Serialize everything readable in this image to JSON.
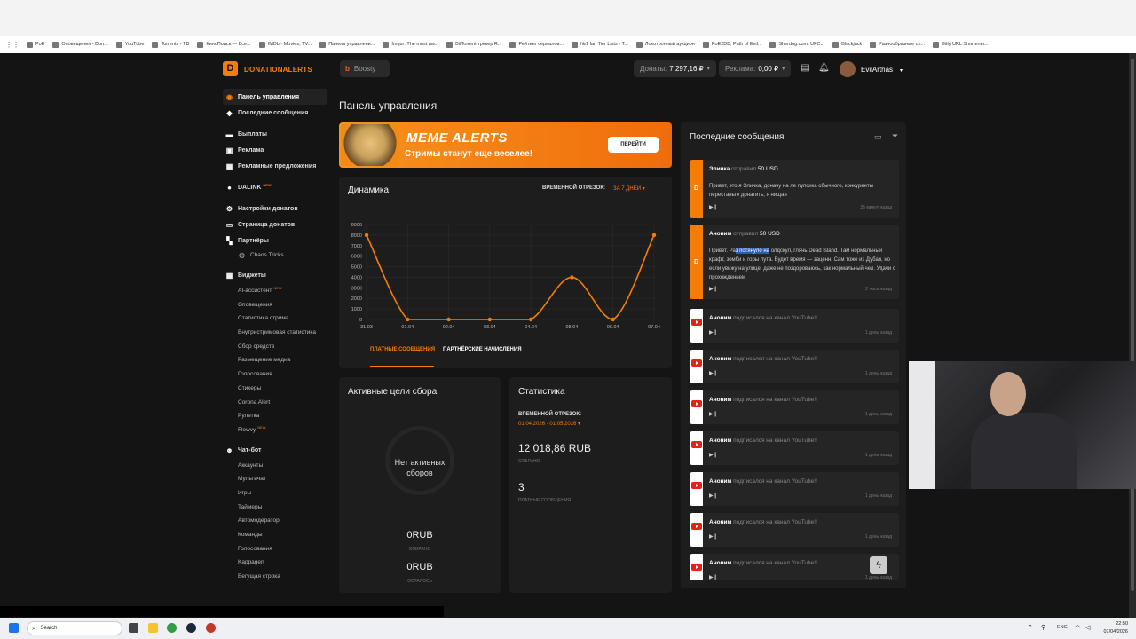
{
  "bookmarks": [
    "PoE",
    "Оповещения - Don...",
    "YouTube",
    "Torrents - TD",
    "КиноПоиск — Все...",
    "IMDb - Movies, TV...",
    "Панель управлени...",
    "Imgur: The most aw...",
    "BitTorrent трекер R...",
    "Рейтинг сериалов...",
    "№1 fan Tier Lists - T...",
    "Лохотронный аукцион",
    "PoE2DB, Path of Exil...",
    "Sherdog.com: UFC...",
    "Blackjack",
    "Разнообразные сп...",
    "Bitly URL Shortener..."
  ],
  "header": {
    "logo_text": "DONATIONALERTS",
    "logo_mark": "D",
    "boosty": "Boosty",
    "donations_label": "Донаты:",
    "donations_value": "7 297,16 ₽",
    "ads_label": "Реклама:",
    "ads_value": "0,00 ₽",
    "username": "EvilArthas"
  },
  "sidebar": {
    "dashboard": "Панель управления",
    "recent": "Последние сообщения",
    "payouts": "Выплаты",
    "ads": "Реклама",
    "ad_offers": "Рекламные предложения",
    "dalink": "DALINK",
    "new": "NEW",
    "donation_settings": "Настройки донатов",
    "donation_page": "Страница донатов",
    "partners": "Партнёры",
    "chaos": "Chaos Tricks",
    "widgets": "Виджеты",
    "widget_items": [
      "AI-ассистент",
      "Оповещения",
      "Статистика стрима",
      "Внутристримовая статистика",
      "Сбор средств",
      "Размещение медиа",
      "Голосования",
      "Стикеры",
      "Corona Alert",
      "Рулетка",
      "Flowvy"
    ],
    "chatbot": "Чат-бот",
    "chatbot_items": [
      "Аккаунты",
      "Мультичат",
      "Игры",
      "Таймеры",
      "Автомодератор",
      "Команды",
      "Голосования",
      "Kappagen",
      "Бегущая строка"
    ]
  },
  "page_title": "Панель управления",
  "banner": {
    "title": "MEME ALERTS",
    "subtitle": "Стримы станут еще веселее!",
    "button": "ПЕРЕЙТИ"
  },
  "dynamics": {
    "title": "Динамика",
    "period_label": "ВРЕМЕННОЙ ОТРЕЗОК:",
    "period_value": "ЗА 7 ДНЕЙ",
    "tab_paid": "ПЛАТНЫЕ СООБЩЕНИЯ",
    "tab_partner": "ПАРТНЁРСКИЕ НАЧИСЛЕНИЯ",
    "accent": "#f57d07"
  },
  "chart_data": {
    "type": "line",
    "categories": [
      "31.03",
      "01.04",
      "02.04",
      "03.04",
      "04.04",
      "05.04",
      "06.04",
      "07.04"
    ],
    "values": [
      8000,
      0,
      0,
      0,
      0,
      4000,
      0,
      8000
    ],
    "ylim": [
      0,
      9000
    ],
    "yticks": [
      0,
      1000,
      2000,
      3000,
      4000,
      5000,
      6000,
      7000,
      8000,
      9000
    ],
    "grid": true
  },
  "goals": {
    "title": "Активные цели сбора",
    "empty": "Нет активных сборов",
    "collected_value": "0RUB",
    "collected_label": "СОБРАНО",
    "left_value": "0RUB",
    "left_label": "ОСТАЛОСЬ"
  },
  "stats": {
    "title": "Статистика",
    "period_label": "ВРЕМЕННОЙ ОТРЕЗОК:",
    "period_value": "01.04.2026 - 01.05.2026",
    "amount": "12 018,86 RUB",
    "amount_label": "СОБРАНО",
    "count": "3",
    "count_label": "ПЛАТНЫЕ СООБЩЕНИЯ"
  },
  "messages": {
    "title": "Последние сообщения",
    "m1": {
      "name": "Эличка",
      "action": "отправил",
      "amount": "50 USD",
      "text": "Привет, это я Эличка, доначу на ле пупсика обычного, конкуренты перестаньте донатить, я нищая",
      "time": "35 минут назад"
    },
    "m2": {
      "name": "Аноним",
      "action": "отправил",
      "amount": "50 USD",
      "t1": "Привет. Ра",
      "t2": "з потянуло на",
      "t3": " олдскул, глянь Dead Island. Там нормальный крафт, зомби и горы лута. Будет время — заценн. Сам тоже из Дубая, но если увижу на улице, даже не поздороваюсь, как нормальный чел. Удачи с прохождением",
      "time": "2 часа назад"
    },
    "yt": {
      "name": "Аноним",
      "action": "подписался на канал YouTube!!",
      "time": "1 день назад"
    }
  },
  "taskbar": {
    "search": "Search",
    "lang": "ENG",
    "time": "22:50",
    "date": "07/04/2026"
  }
}
